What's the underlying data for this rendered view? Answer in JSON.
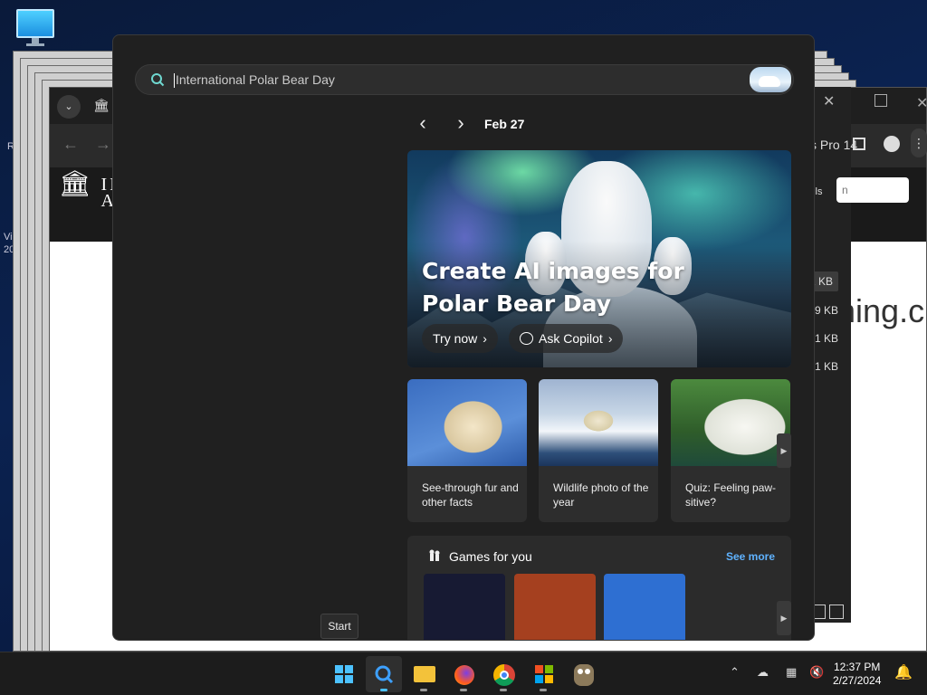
{
  "search": {
    "value": "International Polar Bear Day",
    "placeholder": "International Polar Bear Day"
  },
  "date_nav": {
    "date": "Feb 27"
  },
  "hero": {
    "title": "Create AI images for Polar Bear Day",
    "try_now": "Try now",
    "ask_copilot": "Ask Copilot"
  },
  "cards": [
    {
      "caption": "See-through fur and other facts"
    },
    {
      "caption": "Wildlife photo of the year"
    },
    {
      "caption": "Quiz: Feeling paw-sitive?"
    }
  ],
  "games": {
    "title": "Games for you",
    "see_more": "See more"
  },
  "start_tooltip": "Start",
  "browser_bg": {
    "logo_line1": "IN",
    "logo_line2": "AR",
    "profile_text": "s Pro 14",
    "details": "ails",
    "input_text": "n",
    "sizes": [
      "01 KB",
      "39 KB",
      "1 KB",
      "1 KB"
    ],
    "page_text": "ning.c"
  },
  "desktop_fragments": {
    "a": "R",
    "b": "Vi",
    "c": "20"
  },
  "taskbar": {
    "time": "12:37 PM",
    "date": "2/27/2024",
    "apps": [
      "start",
      "search",
      "file-explorer",
      "firefox",
      "chrome",
      "microsoft-store",
      "gimp"
    ]
  },
  "colors": {
    "flyout_bg": "#202020",
    "accent_link": "#5fb2ff",
    "windows_blue": "#4cc2ff"
  }
}
